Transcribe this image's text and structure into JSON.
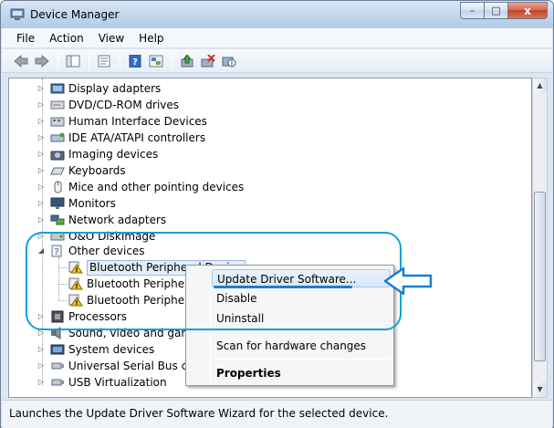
{
  "window": {
    "title": "Device Manager"
  },
  "window_buttons": {
    "minimize": "–",
    "maximize": "□",
    "close": "x"
  },
  "menu": [
    "File",
    "Action",
    "View",
    "Help"
  ],
  "toolbar_icons": [
    "back-icon",
    "forward-icon",
    "console-tree-icon",
    "properties-icon",
    "help-icon",
    "show-hidden-icon",
    "update-driver-icon",
    "uninstall-icon",
    "scan-hardware-icon"
  ],
  "tree": {
    "items": [
      {
        "label": "Display adapters",
        "icon": "display-adapter-icon"
      },
      {
        "label": "DVD/CD-ROM drives",
        "icon": "dvd-drive-icon"
      },
      {
        "label": "Human Interface Devices",
        "icon": "hid-icon"
      },
      {
        "label": "IDE ATA/ATAPI controllers",
        "icon": "ide-controller-icon"
      },
      {
        "label": "Imaging devices",
        "icon": "camera-icon"
      },
      {
        "label": "Keyboards",
        "icon": "keyboard-icon"
      },
      {
        "label": "Mice and other pointing devices",
        "icon": "mouse-icon"
      },
      {
        "label": "Monitors",
        "icon": "monitor-icon"
      },
      {
        "label": "Network adapters",
        "icon": "network-adapter-icon"
      },
      {
        "label": "O&O DiskImage",
        "icon": "disk-icon"
      },
      {
        "label": "Other devices",
        "icon": "unknown-device-icon",
        "expanded": true
      },
      {
        "label": "Bluetooth Peripheral Device",
        "icon": "warning-device-icon",
        "child": true,
        "selected": true
      },
      {
        "label": "Bluetooth Peripheral",
        "icon": "warning-device-icon",
        "child": true
      },
      {
        "label": "Bluetooth Peripheral",
        "icon": "warning-device-icon",
        "child": true
      },
      {
        "label": "Processors",
        "icon": "processor-icon"
      },
      {
        "label": "Sound, video and game",
        "icon": "sound-icon"
      },
      {
        "label": "System devices",
        "icon": "system-device-icon"
      },
      {
        "label": "Universal Serial Bus cont",
        "icon": "usb-icon"
      },
      {
        "label": "USB Virtualization",
        "icon": "usb-icon"
      }
    ]
  },
  "context_menu": {
    "update": "Update Driver Software...",
    "disable": "Disable",
    "uninstall": "Uninstall",
    "scan": "Scan for hardware changes",
    "properties": "Properties"
  },
  "status": {
    "text": "Launches the Update Driver Software Wizard for the selected device."
  },
  "colors": {
    "annotation": "#16a0d8",
    "highlight": "#d9e8f8"
  }
}
